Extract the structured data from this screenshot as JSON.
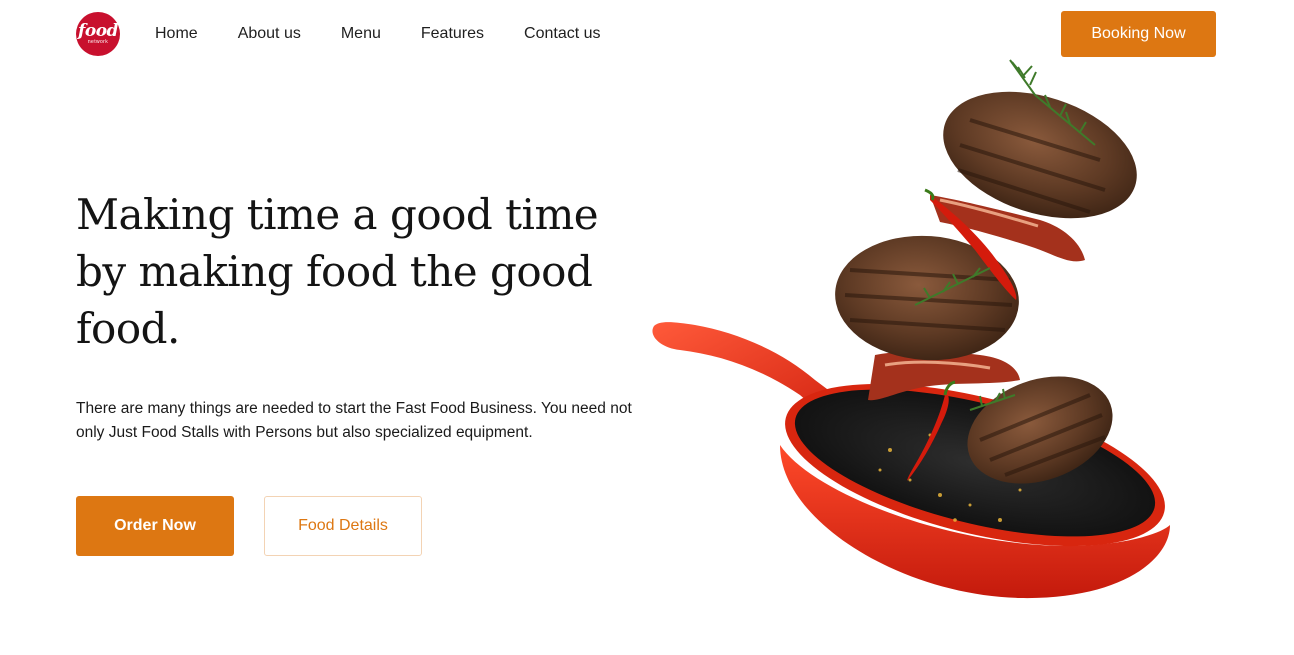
{
  "header": {
    "logo": {
      "text": "food",
      "subtext": "network",
      "color": "#c8102e"
    },
    "nav": [
      {
        "label": "Home"
      },
      {
        "label": "About us"
      },
      {
        "label": "Menu"
      },
      {
        "label": "Features"
      },
      {
        "label": "Contact us"
      }
    ],
    "booking_label": "Booking Now"
  },
  "hero": {
    "headline": "Making time a good time by making food the good food.",
    "description": "There are many things are needed to start the Fast Food Business. You need not only Just Food Stalls with Persons but also specialized equipment.",
    "order_label": "Order Now",
    "details_label": "Food Details",
    "image": "frying-pan-with-flying-burger-patties"
  },
  "colors": {
    "accent": "#dd7712",
    "brand": "#c8102e",
    "outline_border": "#f3d3b4"
  }
}
